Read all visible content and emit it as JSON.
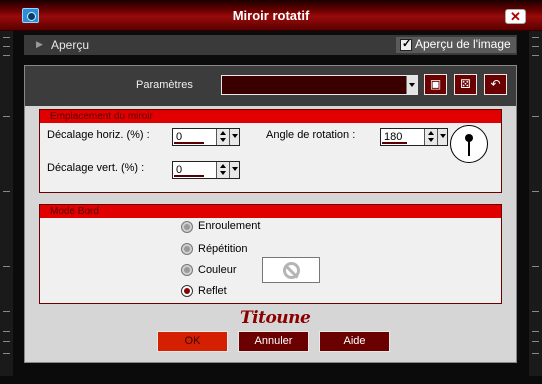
{
  "window": {
    "title": "Miroir rotatif",
    "close_label": "✕"
  },
  "apercu": {
    "label": "Aperçu",
    "show_image_label": "Aperçu de l'image",
    "show_image_checked": true
  },
  "params": {
    "label": "Paramètres",
    "selected": "",
    "tools": [
      "save-icon",
      "randomize-icon",
      "reset-icon"
    ]
  },
  "emplacement": {
    "header": "Emplacement du miroir",
    "horiz_label": "Décalage horiz. (%) :",
    "horiz_value": "0",
    "vert_label": "Décalage vert. (%) :",
    "vert_value": "0",
    "angle_label": "Angle de rotation :",
    "angle_value": "180"
  },
  "mode_bord": {
    "header": "Mode Bord",
    "options": [
      "Enroulement",
      "Répétition",
      "Couleur",
      "Reflet"
    ],
    "selected": "Reflet"
  },
  "brand": "Titoune",
  "buttons": {
    "ok": "OK",
    "cancel": "Annuler",
    "help": "Aide"
  },
  "colors": {
    "accent": "#e00000",
    "dark_red": "#6a0000",
    "ok_button": "#d42000",
    "title_bar": "#9a0b0b"
  }
}
